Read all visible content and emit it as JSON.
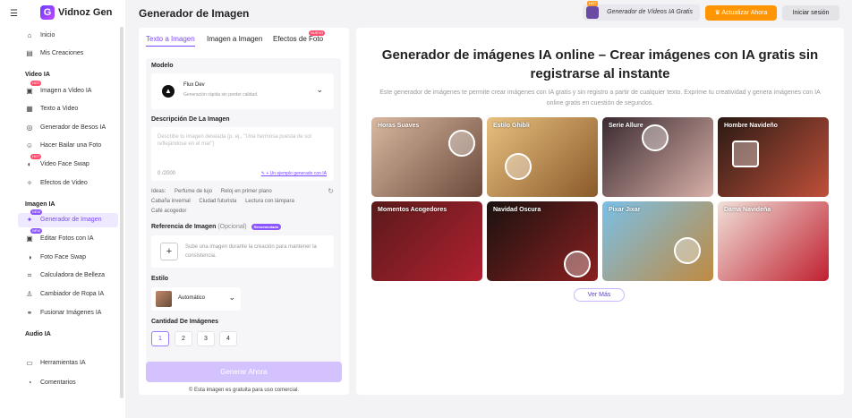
{
  "brand": {
    "name": "Vidnoz Gen",
    "logo_letter": "G"
  },
  "header": {
    "title": "Generador de Imagen",
    "video_button": "Generador de Vídeos IA Gratis",
    "video_badge": "HOT",
    "upgrade_button": "Actualizar Ahora",
    "login_button": "Iniciar sesión"
  },
  "sidebar": {
    "top_items": [
      {
        "label": "Inicio",
        "icon": "home-icon"
      },
      {
        "label": "Mis Creaciones",
        "icon": "folder-icon"
      }
    ],
    "video_section": "Video IA",
    "video_items": [
      {
        "label": "Imagen a Video IA",
        "icon": "image-video-icon",
        "badge": "HOT"
      },
      {
        "label": "Texto a Video",
        "icon": "text-video-icon"
      },
      {
        "label": "Generador de Besos IA",
        "icon": "kiss-icon"
      },
      {
        "label": "Hacer Bailar una Foto",
        "icon": "dance-icon"
      },
      {
        "label": "Video Face Swap",
        "icon": "face-swap-icon",
        "badge": "HOT"
      },
      {
        "label": "Efectos de Video",
        "icon": "effects-icon"
      }
    ],
    "image_section": "Imagen IA",
    "image_items": [
      {
        "label": "Generador de Imagen",
        "icon": "image-gen-icon",
        "badge": "NEW",
        "active": true
      },
      {
        "label": "Editar Fotos con IA",
        "icon": "edit-photo-icon",
        "badge": "NEW"
      },
      {
        "label": "Foto Face Swap",
        "icon": "photo-swap-icon"
      },
      {
        "label": "Calculadora de Belleza",
        "icon": "beauty-icon"
      },
      {
        "label": "Cambiador de Ropa IA",
        "icon": "clothes-icon"
      },
      {
        "label": "Fusionar Imágenes IA",
        "icon": "merge-icon"
      }
    ],
    "audio_section": "Audio IA",
    "bottom_items": [
      {
        "label": "Herramientas IA",
        "icon": "toolbox-icon"
      },
      {
        "label": "Comentarios",
        "icon": "feedback-icon"
      }
    ]
  },
  "form": {
    "tabs": [
      {
        "label": "Texto a Imagen",
        "active": true
      },
      {
        "label": "Imagen a Imagen"
      },
      {
        "label": "Efectos de Foto",
        "badge": "NUEVO"
      }
    ],
    "model_label": "Modelo",
    "model_name": "Flux Dev",
    "model_desc": "Generación rápida sin perder calidad.",
    "desc_label": "Descripción De La Imagen",
    "desc_placeholder": "Describe tu imagen deseada (p. ej., \"Una hermosa puesta de sol reflejándose en el mar\")",
    "counter": "0 /2000",
    "example_link": "+ Un ejemplo generado con IA",
    "ideas_label": "Ideas:",
    "ideas": [
      "Perfume de lujo",
      "Reloj en primer plano",
      "Cabaña invernal",
      "Ciudad futurista",
      "Lectura con lámpara",
      "Café acogedor"
    ],
    "ref_label": "Referencia de Imagen",
    "ref_optional": "(Opcional)",
    "ref_badge": "Recomendado",
    "ref_text": "Sube una imagen durante la creación para mantener la consistencia.",
    "style_label": "Estilo",
    "style_value": "Automático",
    "qty_label": "Cantidad De Imágenes",
    "qty_options": [
      "1",
      "2",
      "3",
      "4"
    ],
    "qty_selected": "1",
    "generate_button": "Generar Ahora",
    "free_note": "Esta imagen es gratuita para uso comercial."
  },
  "hero": {
    "title": "Generador de imágenes IA online – Crear imágenes con IA gratis sin registrarse al instante",
    "subtitle": "Este generador de imágenes te permite crear imágenes con IA gratis y sin registro a partir de cualquier texto. Exprime tu creatividad y genera imágenes con IA online gratis en cuestión de segundos.",
    "cards": [
      {
        "label": "Horas Suaves",
        "color_a": "#d9b8a0",
        "color_b": "#6b4a3c"
      },
      {
        "label": "Estilo Ghibli",
        "color_a": "#e8c080",
        "color_b": "#8a5a2a"
      },
      {
        "label": "Serie Allure",
        "color_a": "#3a2a30",
        "color_b": "#d8b0a8"
      },
      {
        "label": "Hombre Navideño",
        "color_a": "#2a1a14",
        "color_b": "#c0503a"
      },
      {
        "label": "Momentos Acogedores",
        "color_a": "#5a1a1a",
        "color_b": "#b02030"
      },
      {
        "label": "Navidad Oscura",
        "color_a": "#1a1210",
        "color_b": "#8a2020"
      },
      {
        "label": "Pixar Jixar",
        "color_a": "#7ac0e8",
        "color_b": "#c08a40"
      },
      {
        "label": "Dama Navideña",
        "color_a": "#f0e0d8",
        "color_b": "#c02030"
      }
    ],
    "more_button": "Ver Más"
  }
}
